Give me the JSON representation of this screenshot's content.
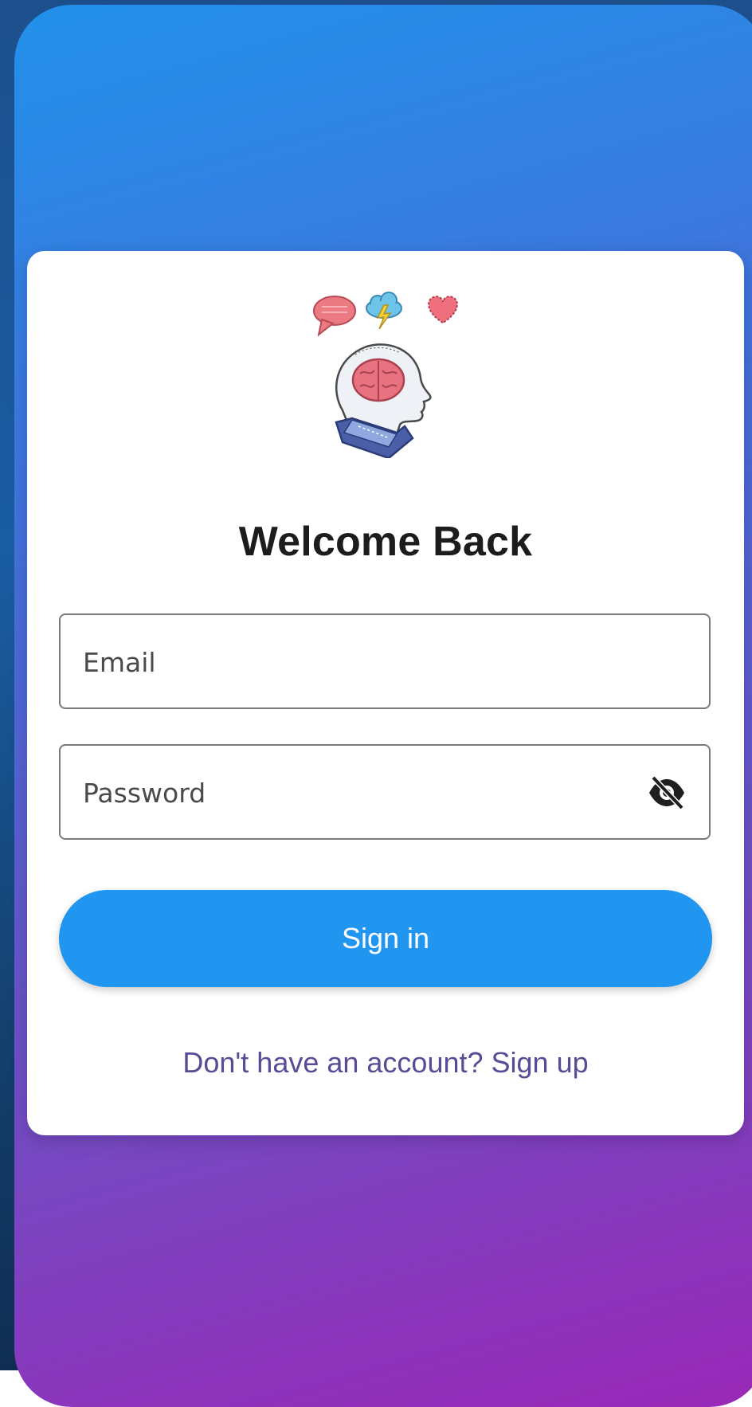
{
  "login": {
    "title": "Welcome Back",
    "email_placeholder": "Email",
    "password_placeholder": "Password",
    "signin_label": "Sign in",
    "signup_link": "Don't have an account? Sign up"
  },
  "icons": {
    "illustration": "mind-head-illustration",
    "password_toggle": "eye-off-icon"
  },
  "colors": {
    "primary_button": "#2196f0",
    "link": "#5b4a95",
    "gradient_top": "#2191ea",
    "gradient_bottom": "#9a28b8"
  }
}
